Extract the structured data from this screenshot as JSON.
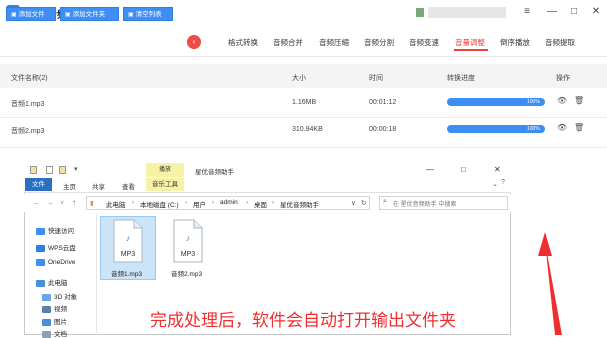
{
  "app": {
    "title": "星优音频助手",
    "logo_letter": "星"
  },
  "titlebar": {
    "user_name": "▓▓▓▓▓▓▓▓▓",
    "menu_glyph": "≡",
    "minimize_glyph": "—",
    "maximize_glyph": "□",
    "close_glyph": "✕"
  },
  "toolbar": {
    "add_file_label": "添加文件",
    "add_folder_label": "添加文件夹",
    "clear_list_label": "清空列表",
    "scroll_left_glyph": "‹"
  },
  "tabs": [
    {
      "label": "格式转换",
      "active": false
    },
    {
      "label": "音频合并",
      "active": false
    },
    {
      "label": "音频压缩",
      "active": false
    },
    {
      "label": "音频分割",
      "active": false
    },
    {
      "label": "音频变速",
      "active": false
    },
    {
      "label": "音量调整",
      "active": true
    },
    {
      "label": "倒序播放",
      "active": false
    },
    {
      "label": "音频提取",
      "active": false
    }
  ],
  "table": {
    "headers": {
      "name": "文件名称(2)",
      "size": "大小",
      "time": "时间",
      "progress": "转换进度",
      "action": "操作"
    },
    "rows": [
      {
        "name": "音频1.mp3",
        "size": "1.16MB",
        "time": "00:01:12",
        "progress": 1.0,
        "progress_text": "100%"
      },
      {
        "name": "音频2.mp3",
        "size": "310.94KB",
        "time": "00:00:18",
        "progress": 1.0,
        "progress_text": "100%"
      }
    ]
  },
  "explorer": {
    "title": "星优音频助手",
    "manage_tab": "播放",
    "ribbon_tabs": {
      "file": "文件",
      "home": "主页",
      "share": "共享",
      "view": "查看",
      "music_tools": "音乐工具"
    },
    "breadcrumbs": [
      "此电脑",
      "本地磁盘 (C:)",
      "用户",
      "admin",
      "桌面",
      "星优音频助手"
    ],
    "search_placeholder": "在 星优音频助手 中搜索",
    "nav_items": [
      {
        "label": "快速访问",
        "color": "#3f8ef5"
      },
      {
        "label": "WPS云盘",
        "color": "#2f7fe6"
      },
      {
        "label": "OneDrive",
        "color": "#3f8ef5"
      },
      {
        "label": "此电脑",
        "color": "#4a90d9"
      },
      {
        "label": "3D 对象",
        "color": "#6aa6e8"
      },
      {
        "label": "视频",
        "color": "#5a7fb0"
      },
      {
        "label": "图片",
        "color": "#4a90d9"
      },
      {
        "label": "文档",
        "color": "#8aa0b8"
      }
    ],
    "files": [
      {
        "name": "音频1.mp3",
        "badge": "MP3",
        "selected": true
      },
      {
        "name": "音频2.mp3",
        "badge": "MP3",
        "selected": false
      }
    ]
  },
  "annotation": {
    "caption": "完成处理后，软件会自动打开输出文件夹"
  },
  "colors": {
    "accent": "#3f8ef5",
    "active_tab": "#ef3f37",
    "caption": "#ef2f2f"
  }
}
